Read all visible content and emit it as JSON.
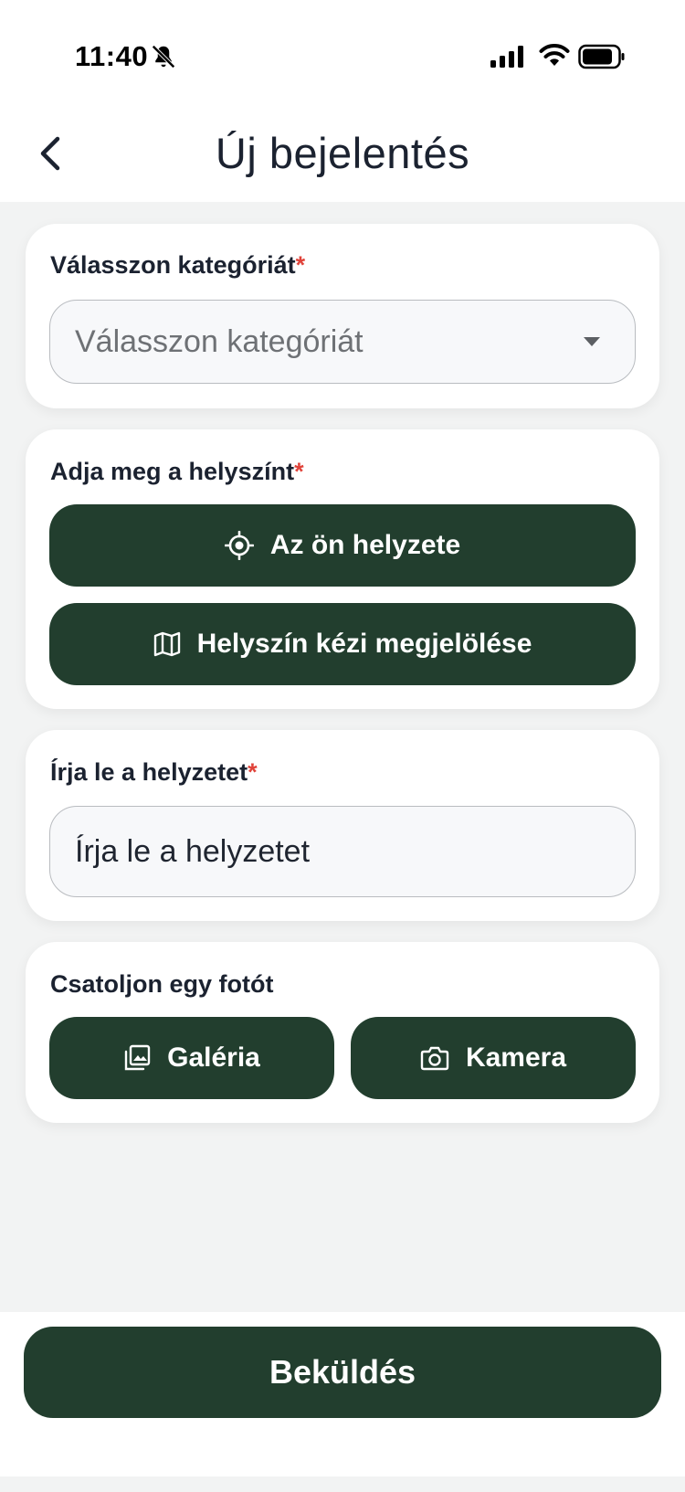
{
  "status_bar": {
    "time": "11:40",
    "icons": [
      "bell-off-icon",
      "signal-icon",
      "wifi-icon",
      "battery-icon"
    ]
  },
  "header": {
    "title": "Új bejelentés",
    "back_icon": "chevron-left-icon"
  },
  "category": {
    "label": "Válasszon kategóriát",
    "required_mark": "*",
    "placeholder": "Válasszon kategóriát"
  },
  "location": {
    "label": "Adja meg a helyszínt",
    "required_mark": "*",
    "current_location_button": "Az ön helyzete",
    "current_location_icon": "crosshair-icon",
    "manual_location_button": "Helyszín kézi megjelölése",
    "manual_location_icon": "map-icon"
  },
  "description": {
    "label": "Írja le a helyzetet",
    "required_mark": "*",
    "placeholder": "Írja le a helyzetet"
  },
  "photo": {
    "label": "Csatoljon egy fotót",
    "gallery_button": "Galéria",
    "gallery_icon": "gallery-icon",
    "camera_button": "Kamera",
    "camera_icon": "camera-icon"
  },
  "submit_button": "Beküldés",
  "colors": {
    "primary": "#223e2e",
    "required": "#e0433a",
    "background": "#f2f3f3"
  }
}
